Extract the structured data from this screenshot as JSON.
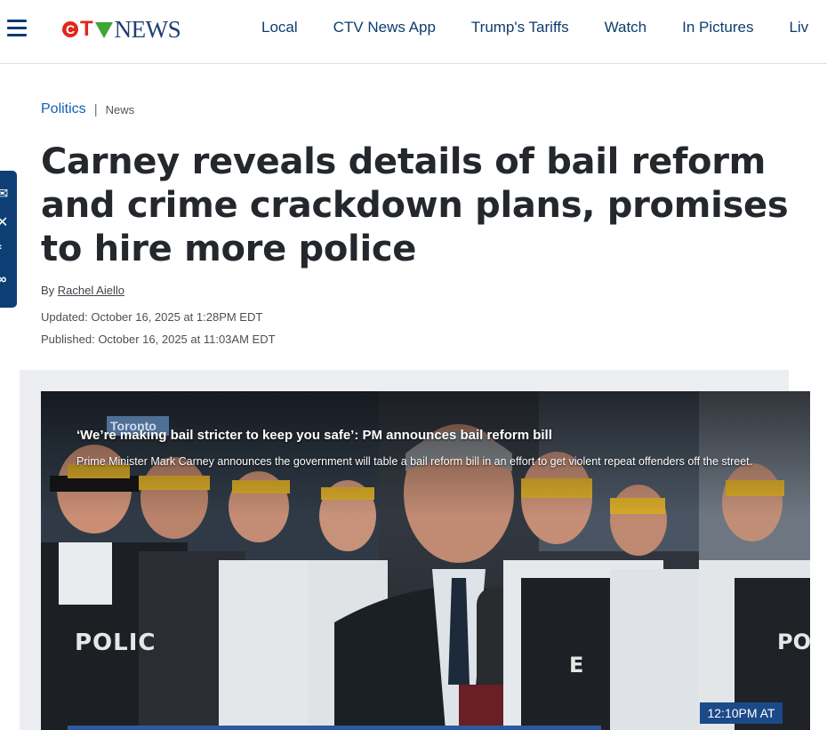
{
  "header": {
    "logo": {
      "c": "C",
      "t": "T",
      "news": "NEWS"
    },
    "nav": [
      "Local",
      "CTV News App",
      "Trump's Tariffs",
      "Watch",
      "In Pictures",
      "Liv"
    ]
  },
  "share_bar": {
    "icons": [
      "email-icon",
      "x-icon",
      "facebook-icon",
      "link-icon"
    ]
  },
  "article": {
    "section": "Politics",
    "separator": "|",
    "type": "News",
    "headline": "Carney reveals details of bail reform and crime crackdown plans, promises to hire more police",
    "byline_prefix": "By",
    "author": "Rachel Aiello",
    "updated": "Updated: October 16, 2025 at 1:28PM EDT",
    "published": "Published: October 16, 2025 at 11:03AM EDT"
  },
  "video": {
    "title": "‘We’re making bail stricter to keep you safe’: PM announces bail reform bill",
    "description": "Prime Minister Mark Carney announces the government will table a bail reform bill in an effort to get violent repeat offenders off the street.",
    "timestamp": "12:10PM AT",
    "location_sign": "Toronto",
    "vest_text_left": "POLIC",
    "vest_text_right": "POL",
    "vest_text_center": "E"
  },
  "colors": {
    "brand_blue": "#0e3d6e",
    "link_blue": "#1160b7",
    "ctv_red": "#e1261c",
    "ctv_green": "#3fa535"
  }
}
